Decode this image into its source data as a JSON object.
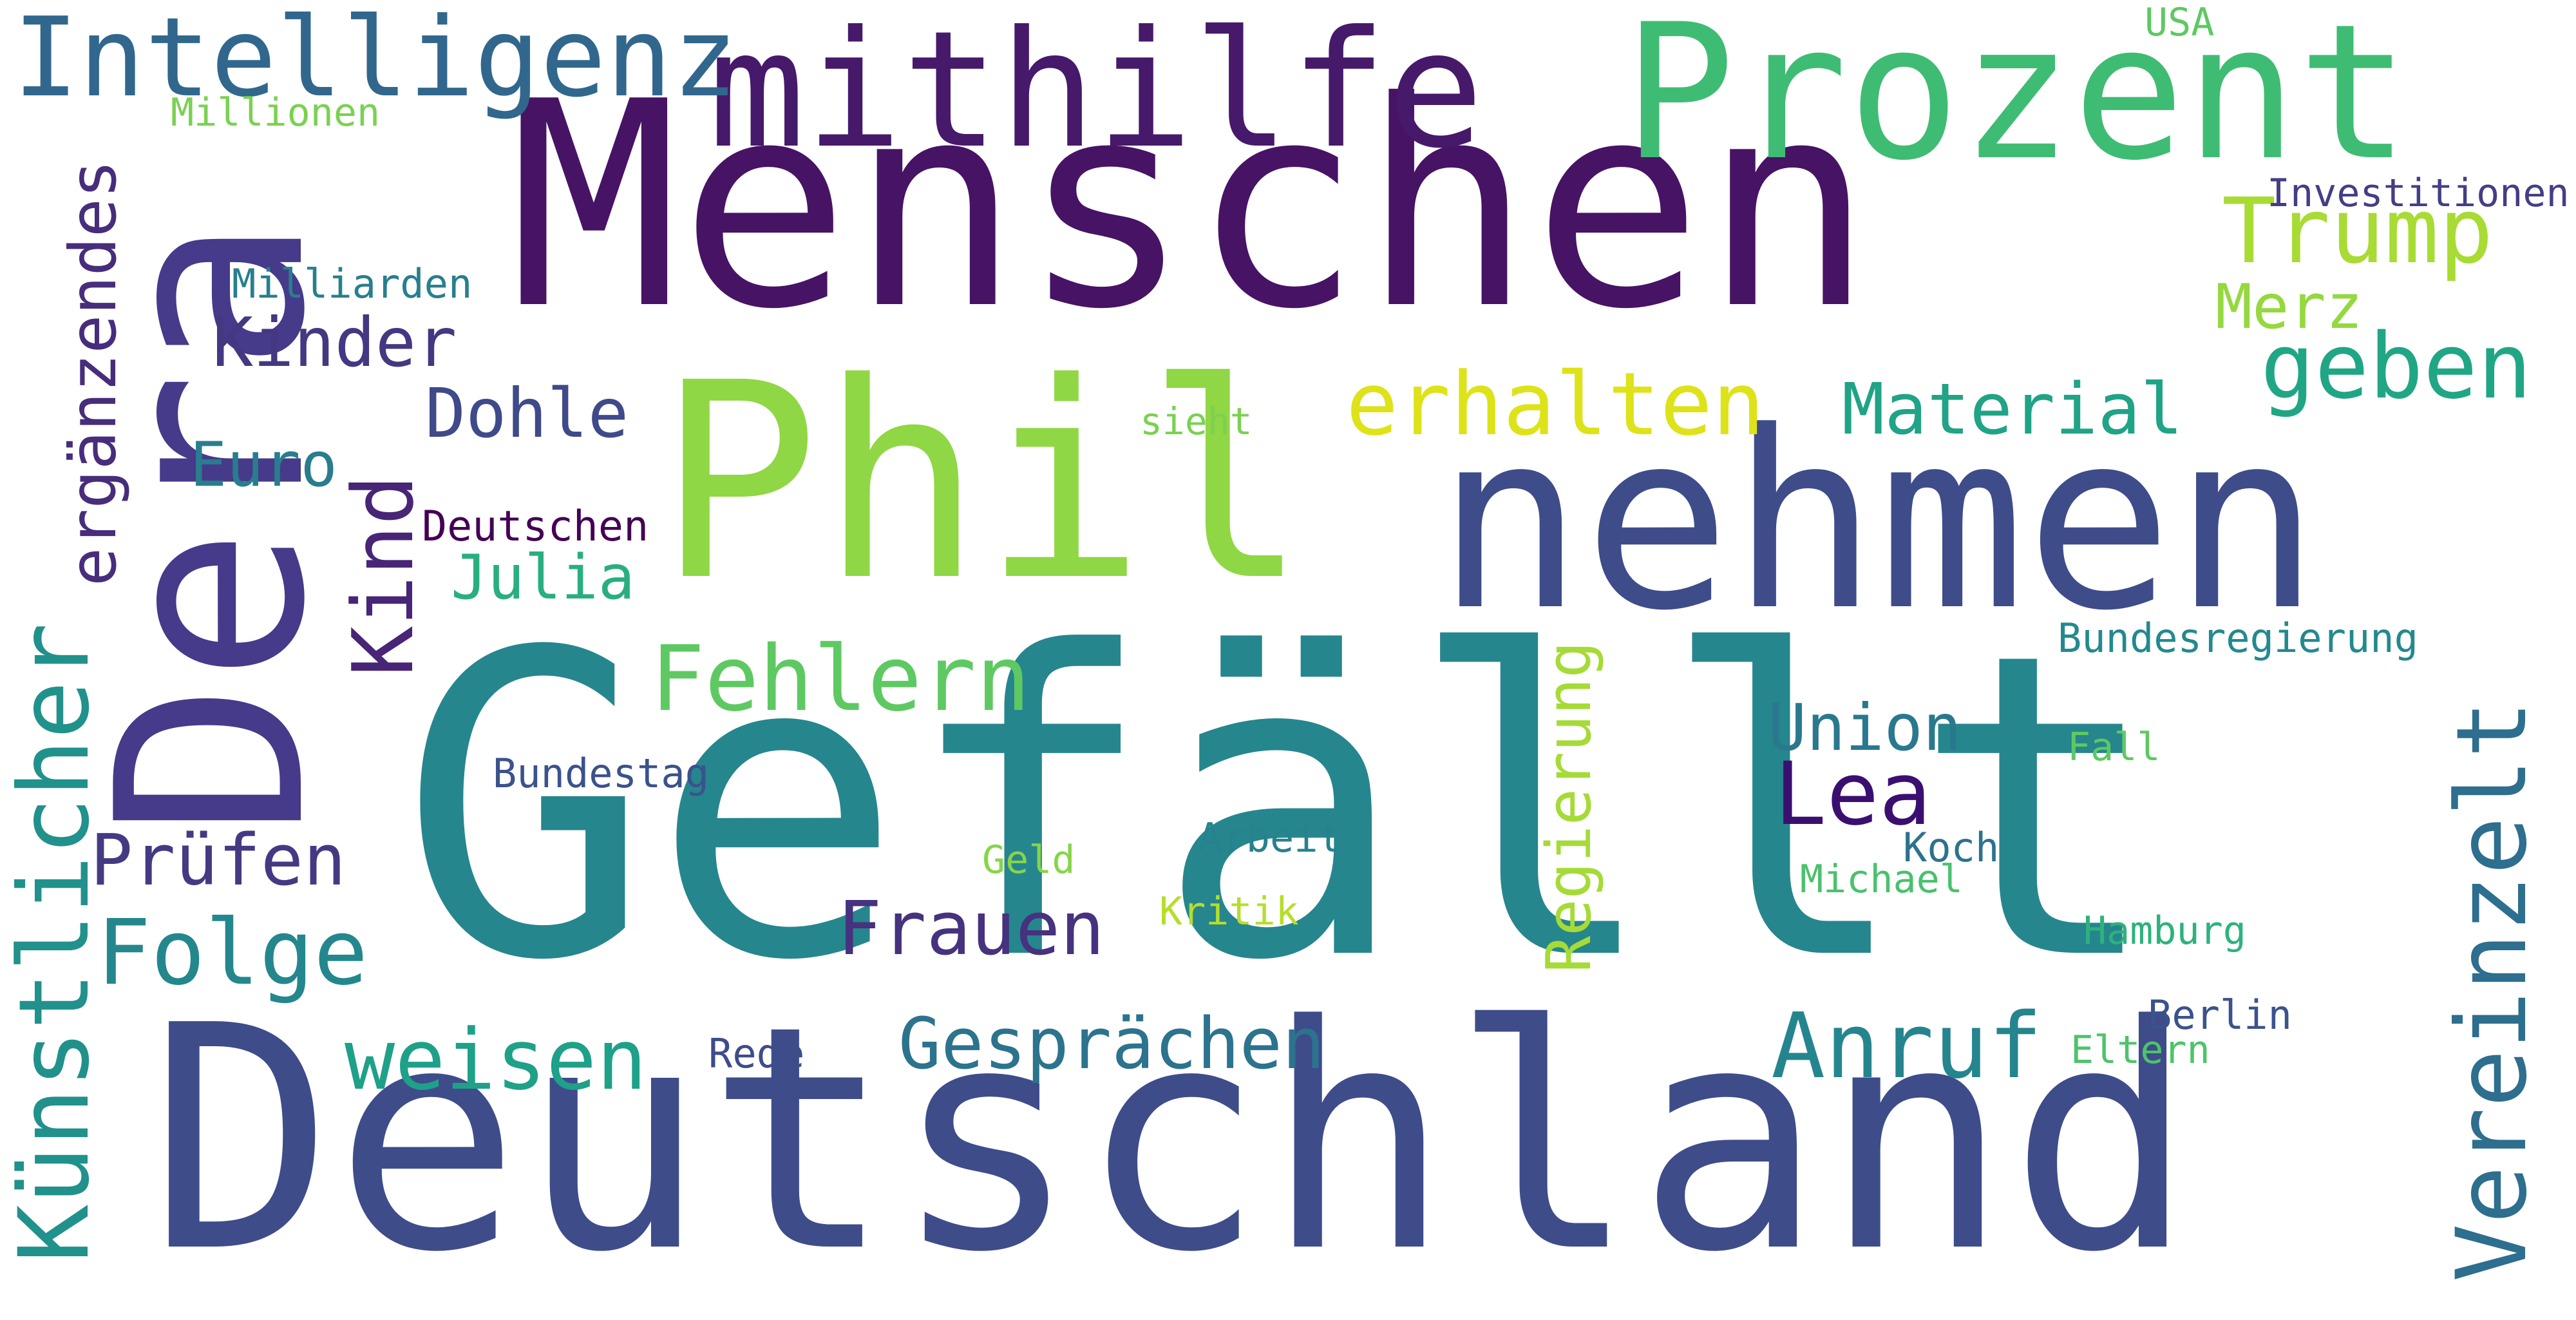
{
  "words": [
    {
      "text": "Gefällt",
      "color": "#26868d"
    },
    {
      "text": "Deutschland",
      "color": "#3e4c8a"
    },
    {
      "text": "Menschen",
      "color": "#471365"
    },
    {
      "text": "nehmen",
      "color": "#3e4c8a"
    },
    {
      "text": "Phil",
      "color": "#8fd744"
    },
    {
      "text": "Dera",
      "color": "#463a8a"
    },
    {
      "text": "Prozent",
      "color": "#3fbc73"
    },
    {
      "text": "mithilfe",
      "color": "#46196b"
    },
    {
      "text": "Intelligenz",
      "color": "#31678d"
    },
    {
      "text": "Künstlicher",
      "color": "#21918c"
    },
    {
      "text": "Vereinzelt",
      "color": "#2e6e8e"
    },
    {
      "text": "ergänzendes",
      "color": "#472d7b"
    },
    {
      "text": "Trump",
      "color": "#a8db34"
    },
    {
      "text": "erhalten",
      "color": "#dde318"
    },
    {
      "text": "geben",
      "color": "#21a685"
    },
    {
      "text": "Merz",
      "color": "#95d840"
    },
    {
      "text": "Material",
      "color": "#20a386"
    },
    {
      "text": "Investitionen",
      "color": "#433e85"
    },
    {
      "text": "USA",
      "color": "#5ec962"
    },
    {
      "text": "Millionen",
      "color": "#7ad151"
    },
    {
      "text": "Milliarden",
      "color": "#277f8e"
    },
    {
      "text": "Kinder",
      "color": "#453781"
    },
    {
      "text": "Dohle",
      "color": "#3e4a89"
    },
    {
      "text": "sieht",
      "color": "#7ad151"
    },
    {
      "text": "Kind",
      "color": "#482576"
    },
    {
      "text": "Euro",
      "color": "#287d8e"
    },
    {
      "text": "Deutschen",
      "color": "#440154"
    },
    {
      "text": "Julia",
      "color": "#29af7f"
    },
    {
      "text": "Fehlern",
      "color": "#5ec962"
    },
    {
      "text": "Regierung",
      "color": "#a5db36"
    },
    {
      "text": "Bundesregierung",
      "color": "#23898e"
    },
    {
      "text": "Union",
      "color": "#2a788e"
    },
    {
      "text": "Lea",
      "color": "#3b0f70"
    },
    {
      "text": "Fall",
      "color": "#5ec962"
    },
    {
      "text": "Bundestag",
      "color": "#3b528b"
    },
    {
      "text": "Prüfen",
      "color": "#443a83"
    },
    {
      "text": "Arbeit",
      "color": "#26828e"
    },
    {
      "text": "Koch",
      "color": "#2c728e"
    },
    {
      "text": "Geld",
      "color": "#86d549"
    },
    {
      "text": "Michael",
      "color": "#4ac16d"
    },
    {
      "text": "Kritik",
      "color": "#b5de2b"
    },
    {
      "text": "Folge",
      "color": "#24878e"
    },
    {
      "text": "Frauen",
      "color": "#46327e"
    },
    {
      "text": "Hamburg",
      "color": "#2db27d"
    },
    {
      "text": "weisen",
      "color": "#1fa088"
    },
    {
      "text": "Gesprächen",
      "color": "#2c738e"
    },
    {
      "text": "Anruf",
      "color": "#25858e"
    },
    {
      "text": "Berlin",
      "color": "#3b528b"
    },
    {
      "text": "Rede",
      "color": "#3e4c8a"
    },
    {
      "text": "Eltern",
      "color": "#4ec36b"
    }
  ]
}
